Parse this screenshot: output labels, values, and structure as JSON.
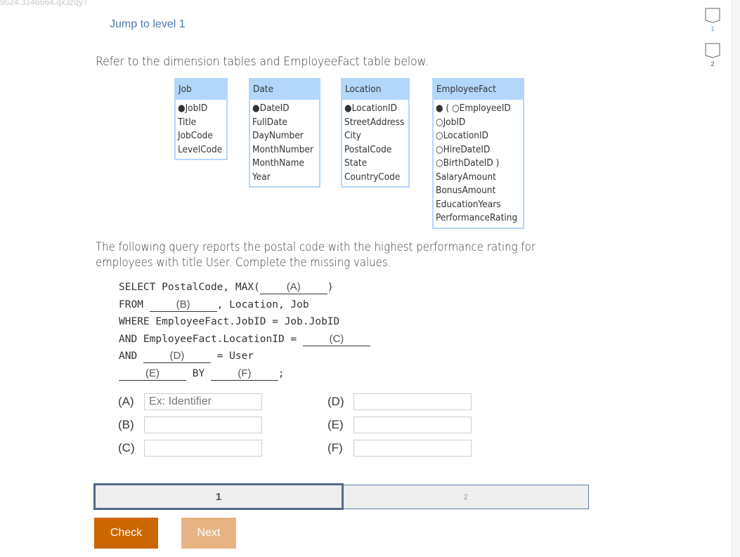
{
  "page": {
    "url_fragment": "9524.3146664.qx3zqy7",
    "jump_link": "Jump to level 1",
    "intro": "Refer to the dimension tables and EmployeeFact table below."
  },
  "tables": {
    "job": {
      "name": "Job",
      "columns": [
        "●JobID",
        "Title",
        "JobCode",
        "LevelCode"
      ]
    },
    "date": {
      "name": "Date",
      "columns": [
        "●DateID",
        "FullDate",
        "DayNumber",
        "MonthNumber",
        "MonthName",
        "Year"
      ]
    },
    "location": {
      "name": "Location",
      "columns": [
        "●LocationID",
        "StreetAddress",
        "City",
        "PostalCode",
        "State",
        "CountryCode"
      ]
    },
    "fact": {
      "name": "EmployeeFact",
      "columns": [
        "● ( ○EmployeeID",
        "○JobID",
        "○LocationID",
        "○HireDateID",
        "○BirthDateID )",
        "SalaryAmount",
        "BonusAmount",
        "EducationYears",
        "PerformanceRating"
      ]
    }
  },
  "question": {
    "line1": "The following query reports the postal code with the highest performance rating for",
    "line2": "employees with title User. Complete the missing values."
  },
  "query": {
    "l1_pre": "SELECT PostalCode, MAX(",
    "l1_blank": "(A)",
    "l1_post": ")",
    "l2_pre": "FROM ",
    "l2_blank": "(B)",
    "l2_post": ", Location, Job",
    "l3": "WHERE EmployeeFact.JobID = Job.JobID",
    "l4_pre": "AND EmployeeFact.LocationID = ",
    "l4_blank": "(C)",
    "l5_pre": "AND ",
    "l5_blank": "(D)",
    "l5_post": " = User",
    "l6_blank1": "(E)",
    "l6_mid": " BY ",
    "l6_blank2": "(F)",
    "l6_post": ";"
  },
  "answers": {
    "a": {
      "label": "(A)",
      "value": "",
      "placeholder": "Ex: Identifier"
    },
    "b": {
      "label": "(B)",
      "value": "",
      "placeholder": ""
    },
    "c": {
      "label": "(C)",
      "value": "",
      "placeholder": ""
    },
    "d": {
      "label": "(D)",
      "value": "",
      "placeholder": ""
    },
    "e": {
      "label": "(E)",
      "value": "",
      "placeholder": ""
    },
    "f": {
      "label": "(F)",
      "value": "",
      "placeholder": ""
    }
  },
  "progress": {
    "steps": [
      {
        "label": "1",
        "state": "active"
      },
      {
        "label": "2",
        "state": "inactive"
      }
    ]
  },
  "buttons": {
    "check": "Check",
    "next": "Next"
  },
  "levels": [
    {
      "number": "1"
    },
    {
      "number": "2"
    }
  ],
  "colors": {
    "accent_link": "#4e7bb0",
    "table_header": "#b3d7fb",
    "check_button": "#cc6600",
    "next_button_disabled": "#e8b383",
    "progress_active_border": "#53698a"
  }
}
